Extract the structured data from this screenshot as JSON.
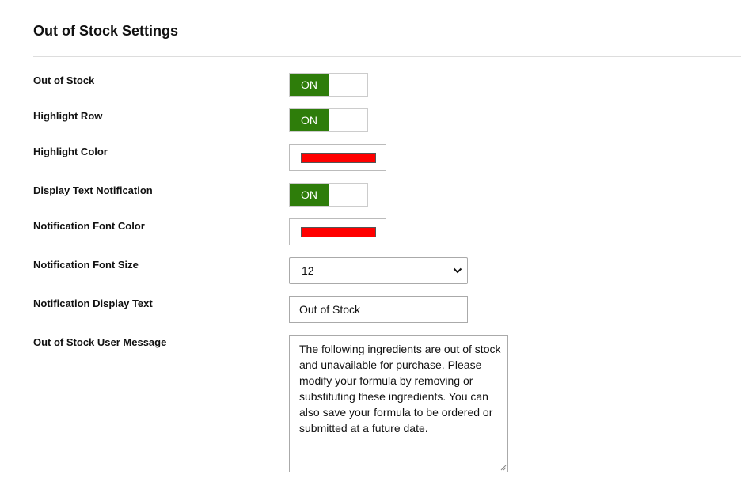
{
  "section": {
    "title": "Out of Stock Settings"
  },
  "settings": {
    "out_of_stock": {
      "label": "Out of Stock",
      "state": "ON"
    },
    "highlight_row": {
      "label": "Highlight Row",
      "state": "ON"
    },
    "highlight_color": {
      "label": "Highlight Color",
      "color": "#ff0000"
    },
    "display_text_notification": {
      "label": "Display Text Notification",
      "state": "ON"
    },
    "notification_font_color": {
      "label": "Notification Font Color",
      "color": "#ff0000"
    },
    "notification_font_size": {
      "label": "Notification Font Size",
      "value": "12"
    },
    "notification_display_text": {
      "label": "Notification Display Text",
      "value": "Out of Stock"
    },
    "user_message": {
      "label": "Out of Stock User Message",
      "value": "The following ingredients are out of stock and unavailable for purchase. Please modify your formula by removing or substituting these ingredients. You can also save your formula to be ordered or submitted at a future date."
    }
  },
  "colors": {
    "toggle_on": "#2e7d0a"
  }
}
